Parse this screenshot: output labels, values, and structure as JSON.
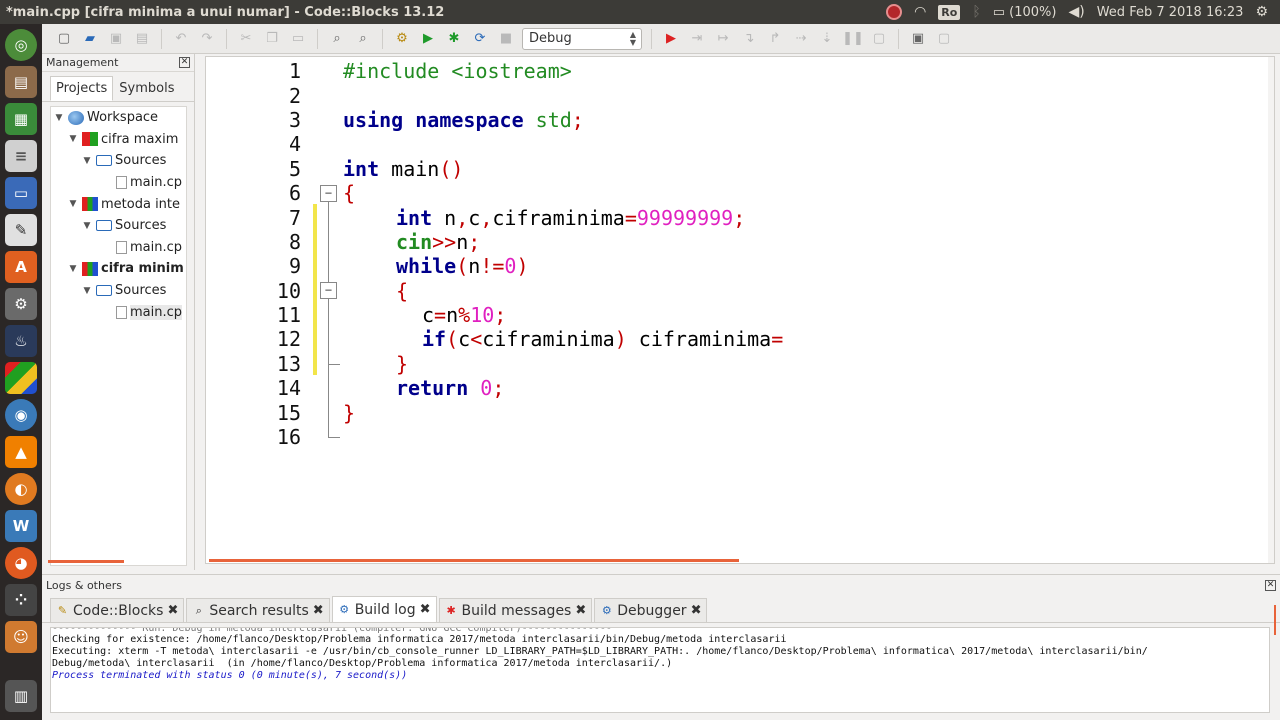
{
  "window": {
    "title": "*main.cpp [cifra minima a unui numar] - Code::Blocks 13.12"
  },
  "tray": {
    "keyboard": "Ro",
    "battery": "(100%)",
    "clock": "Wed Feb  7 2018 16:23"
  },
  "toolbar": {
    "build_target": "Debug"
  },
  "management": {
    "header": "Management",
    "tabs": [
      "Projects",
      "Symbols"
    ],
    "tree": [
      {
        "label": "Workspace"
      },
      {
        "label": "cifra maxim"
      },
      {
        "label": "Sources"
      },
      {
        "label": "main.cp"
      },
      {
        "label": "metoda inte"
      },
      {
        "label": "Sources"
      },
      {
        "label": "main.cp"
      },
      {
        "label": "cifra minim"
      },
      {
        "label": "Sources"
      },
      {
        "label": "main.cp"
      }
    ]
  },
  "editor": {
    "line_numbers": [
      "1",
      "2",
      "3",
      "4",
      "5",
      "6",
      "7",
      "8",
      "9",
      "10",
      "11",
      "12",
      "13",
      "14",
      "15",
      "16"
    ],
    "code": {
      "l1": "#include <iostream>",
      "l3_kw": "using namespace",
      "l3_id": " std",
      "l3_op": ";",
      "l5_kw": "int",
      "l5_id": " main",
      "l5_op": "()",
      "l6": "{",
      "l7_kw": "int",
      "l7_id1": " n",
      "l7_op1": ",",
      "l7_id2": "c",
      "l7_op2": ",",
      "l7_id3": "ciframinima",
      "l7_op3": "=",
      "l7_num": "99999999",
      "l7_op4": ";",
      "l8_cin": "cin",
      "l8_op": ">>",
      "l8_id": "n",
      "l8_op2": ";",
      "l9_kw": "while",
      "l9_op1": "(",
      "l9_id": "n",
      "l9_op2": "!=",
      "l9_num": "0",
      "l9_op3": ")",
      "l10": "{",
      "l11_id1": "c",
      "l11_op1": "=",
      "l11_id2": "n",
      "l11_op2": "%",
      "l11_num": "10",
      "l11_op3": ";",
      "l12_kw": "if",
      "l12_op1": "(",
      "l12_id1": "c",
      "l12_op2": "<",
      "l12_id2": "ciframinima",
      "l12_op3": ")",
      "l12_id3": " ciframinima",
      "l12_op4": "=",
      "l13": "}",
      "l14_kw": "return",
      "l14_num": " 0",
      "l14_op": ";",
      "l15": "}"
    }
  },
  "logs": {
    "header": "Logs & others",
    "tabs": [
      "Code::Blocks",
      "Search results",
      "Build log",
      "Build messages",
      "Debugger"
    ],
    "lines": [
      "-------------- Run: Debug in metoda interclasarii (compiler: GNU GCC Compiler)---------------",
      "Checking for existence: /home/flanco/Desktop/Problema informatica 2017/metoda interclasarii/bin/Debug/metoda interclasarii",
      "Executing: xterm -T metoda\\ interclasarii -e /usr/bin/cb_console_runner LD_LIBRARY_PATH=$LD_LIBRARY_PATH:. /home/flanco/Desktop/Problema\\ informatica\\ 2017/metoda\\ interclasarii/bin/",
      "Debug/metoda\\ interclasarii  (in /home/flanco/Desktop/Problema informatica 2017/metoda interclasarii/.)",
      "Process terminated with status 0 (0 minute(s), 7 second(s))"
    ]
  }
}
